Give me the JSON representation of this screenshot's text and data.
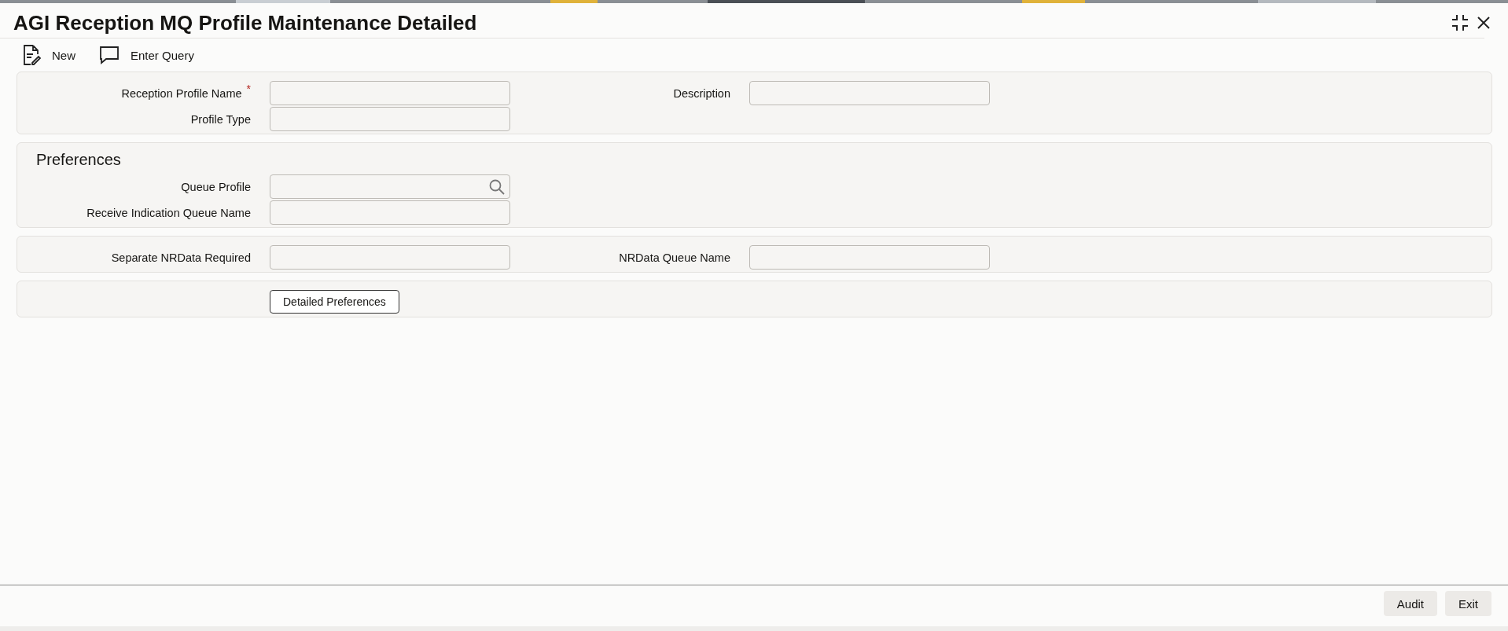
{
  "window": {
    "title": "AGI Reception MQ Profile Maintenance Detailed"
  },
  "toolbar": [
    {
      "kind": "new",
      "label": "New"
    },
    {
      "kind": "query",
      "label": "Enter Query"
    }
  ],
  "sections": [
    {
      "rows": [
        [
          {
            "label": "Reception Profile Name",
            "required_mark": "*",
            "kind": "text"
          },
          {
            "label": "Description",
            "kind": "text"
          }
        ],
        [
          {
            "label": "Profile Type",
            "kind": "text"
          }
        ]
      ]
    },
    {
      "heading": "Preferences",
      "rows": [
        [
          {
            "label": "Queue Profile",
            "kind": "lookup"
          }
        ],
        [
          {
            "label": "Receive Indication Queue Name",
            "kind": "text"
          }
        ]
      ]
    },
    {
      "rows": [
        [
          {
            "label": "Separate NRData Required",
            "kind": "text"
          },
          {
            "label": "NRData Queue Name",
            "kind": "text"
          }
        ]
      ]
    },
    {
      "button": "Detailed Preferences"
    }
  ],
  "footer": {
    "buttons": [
      "Audit",
      "Exit"
    ]
  }
}
